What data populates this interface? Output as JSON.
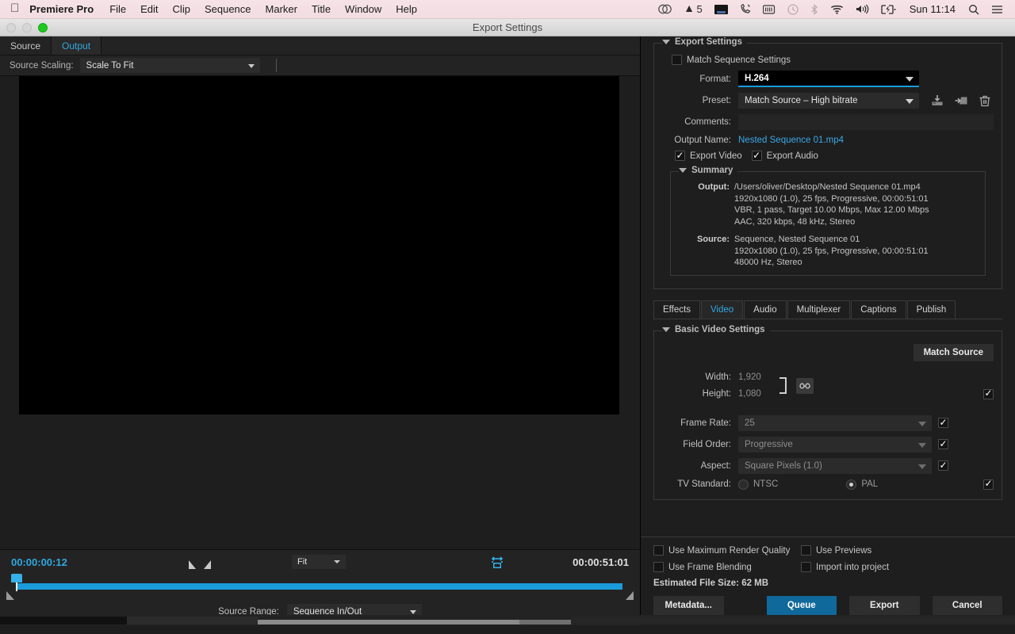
{
  "menubar": {
    "apple_icon": "apple-logo",
    "app_name": "Premiere Pro",
    "menus": [
      "File",
      "Edit",
      "Clip",
      "Sequence",
      "Marker",
      "Title",
      "Window",
      "Help"
    ],
    "status": {
      "creative_cloud_icon": "creative-cloud-icon",
      "adobe_icon": "adobe-a-icon",
      "adobe_count": "5",
      "display_icon": "display-icon",
      "phone_icon": "phone-icon",
      "battery_meter_icon": "battery-meter-icon",
      "time_machine_icon": "time-machine-icon",
      "bluetooth_icon": "bluetooth-icon",
      "wifi_icon": "wifi-icon",
      "volume_icon": "volume-icon",
      "battery_charging_icon": "battery-charging-icon",
      "clock": "Sun 11:14",
      "search_icon": "search-icon",
      "notification_center_icon": "notification-center-icon"
    }
  },
  "window": {
    "title": "Export Settings",
    "traffic_lights": [
      "close",
      "minimize",
      "maximize"
    ]
  },
  "preview": {
    "tabs": [
      {
        "label": "Source",
        "active": false
      },
      {
        "label": "Output",
        "active": true
      }
    ],
    "source_scaling_label": "Source Scaling:",
    "source_scaling_value": "Scale To Fit",
    "timeline": {
      "current_time": "00:00:00:12",
      "duration": "00:00:51:01",
      "zoom_level": "Fit",
      "in_point_icon": "in-point-icon",
      "out_point_icon": "out-point-icon",
      "fit_to_frame_icon": "fit-to-frame-icon",
      "source_range_label": "Source Range:",
      "source_range_value": "Sequence In/Out"
    }
  },
  "export_settings": {
    "group_title": "Export Settings",
    "match_sequence_settings": {
      "label": "Match Sequence Settings",
      "checked": false
    },
    "format_label": "Format:",
    "format_value": "H.264",
    "preset_label": "Preset:",
    "preset_value": "Match Source – High bitrate",
    "preset_icons": [
      "save-preset-icon",
      "import-preset-icon",
      "delete-preset-icon"
    ],
    "comments_label": "Comments:",
    "comments_value": "",
    "output_name_label": "Output Name:",
    "output_name_value": "Nested Sequence 01.mp4",
    "export_video": {
      "label": "Export Video",
      "checked": true
    },
    "export_audio": {
      "label": "Export Audio",
      "checked": true
    }
  },
  "summary": {
    "title": "Summary",
    "output_key": "Output:",
    "output_lines": [
      "/Users/oliver/Desktop/Nested Sequence 01.mp4",
      "1920x1080 (1.0), 25 fps, Progressive, 00:00:51:01",
      "VBR, 1 pass, Target 10.00 Mbps, Max 12.00 Mbps",
      "AAC, 320 kbps, 48 kHz, Stereo"
    ],
    "source_key": "Source:",
    "source_lines": [
      "Sequence, Nested Sequence 01",
      "1920x1080 (1.0), 25 fps, Progressive, 00:00:51:01",
      "48000 Hz, Stereo"
    ]
  },
  "settings_tabs": [
    {
      "label": "Effects",
      "active": false
    },
    {
      "label": "Video",
      "active": true
    },
    {
      "label": "Audio",
      "active": false
    },
    {
      "label": "Multiplexer",
      "active": false
    },
    {
      "label": "Captions",
      "active": false
    },
    {
      "label": "Publish",
      "active": false
    }
  ],
  "basic_video": {
    "group_title": "Basic Video Settings",
    "match_source_button": "Match Source",
    "width_label": "Width:",
    "width_value": "1,920",
    "height_label": "Height:",
    "height_value": "1,080",
    "link_icon": "link-chain-icon",
    "frame_rate_label": "Frame Rate:",
    "frame_rate_value": "25",
    "field_order_label": "Field Order:",
    "field_order_value": "Progressive",
    "aspect_label": "Aspect:",
    "aspect_value": "Square Pixels (1.0)",
    "tv_standard_label": "TV Standard:",
    "tv_ntsc_label": "NTSC",
    "tv_pal_label": "PAL",
    "tv_selected": "PAL"
  },
  "bottom": {
    "use_max_render_quality": {
      "label": "Use Maximum Render Quality",
      "checked": false
    },
    "use_previews": {
      "label": "Use Previews",
      "checked": false
    },
    "use_frame_blending": {
      "label": "Use Frame Blending",
      "checked": false
    },
    "import_into_project": {
      "label": "Import into project",
      "checked": false
    },
    "estimated_file_size": "Estimated File Size:  62 MB",
    "metadata_button": "Metadata...",
    "queue_button": "Queue",
    "export_button": "Export",
    "cancel_button": "Cancel"
  },
  "colors": {
    "accent_blue": "#2fa8e0",
    "primary_button": "#10699b",
    "panel_bg": "#1e1e1e",
    "menubar_bg": "#f4e1e5"
  }
}
